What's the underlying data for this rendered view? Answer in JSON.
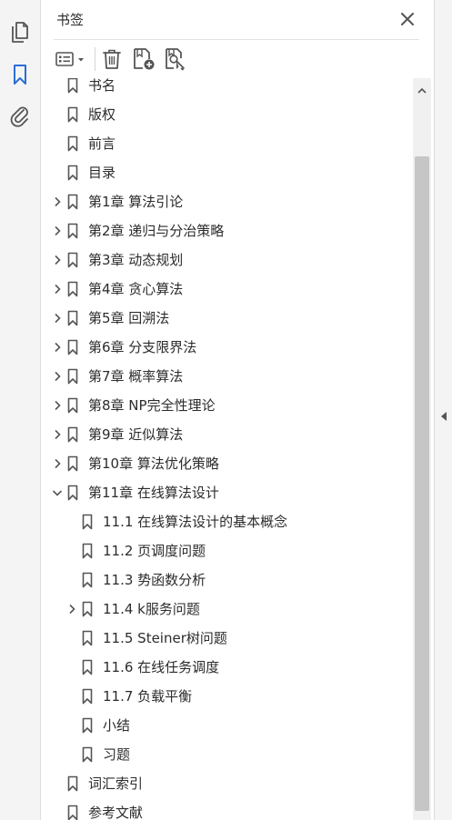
{
  "rail": {
    "items": [
      {
        "name": "page-thumbnails-icon",
        "color": "#555555"
      },
      {
        "name": "bookmark-icon",
        "color": "#2b6fd6"
      },
      {
        "name": "attachment-icon",
        "color": "#555555"
      }
    ]
  },
  "panel": {
    "title": "书签",
    "toolbar": [
      "options-menu-icon",
      "delete-icon",
      "new-bookmark-icon",
      "find-bookmark-icon"
    ]
  },
  "bookmarks": [
    {
      "label": "书名",
      "level": 0,
      "expandable": false,
      "expanded": false
    },
    {
      "label": "版权",
      "level": 0,
      "expandable": false,
      "expanded": false
    },
    {
      "label": "前言",
      "level": 0,
      "expandable": false,
      "expanded": false
    },
    {
      "label": "目录",
      "level": 0,
      "expandable": false,
      "expanded": false
    },
    {
      "label": "第1章 算法引论",
      "level": 0,
      "expandable": true,
      "expanded": false
    },
    {
      "label": "第2章 递归与分治策略",
      "level": 0,
      "expandable": true,
      "expanded": false
    },
    {
      "label": "第3章 动态规划",
      "level": 0,
      "expandable": true,
      "expanded": false
    },
    {
      "label": "第4章 贪心算法",
      "level": 0,
      "expandable": true,
      "expanded": false
    },
    {
      "label": "第5章 回溯法",
      "level": 0,
      "expandable": true,
      "expanded": false
    },
    {
      "label": "第6章 分支限界法",
      "level": 0,
      "expandable": true,
      "expanded": false
    },
    {
      "label": "第7章 概率算法",
      "level": 0,
      "expandable": true,
      "expanded": false
    },
    {
      "label": "第8章 NP完全性理论",
      "level": 0,
      "expandable": true,
      "expanded": false
    },
    {
      "label": "第9章 近似算法",
      "level": 0,
      "expandable": true,
      "expanded": false
    },
    {
      "label": "第10章 算法优化策略",
      "level": 0,
      "expandable": true,
      "expanded": false
    },
    {
      "label": "第11章 在线算法设计",
      "level": 0,
      "expandable": true,
      "expanded": true
    },
    {
      "label": "11.1 在线算法设计的基本概念",
      "level": 1,
      "expandable": false,
      "expanded": false
    },
    {
      "label": "11.2 页调度问题",
      "level": 1,
      "expandable": false,
      "expanded": false
    },
    {
      "label": "11.3 势函数分析",
      "level": 1,
      "expandable": false,
      "expanded": false
    },
    {
      "label": "11.4 k服务问题",
      "level": 1,
      "expandable": true,
      "expanded": false
    },
    {
      "label": "11.5 Steiner树问题",
      "level": 1,
      "expandable": false,
      "expanded": false
    },
    {
      "label": "11.6 在线任务调度",
      "level": 1,
      "expandable": false,
      "expanded": false
    },
    {
      "label": "11.7 负载平衡",
      "level": 1,
      "expandable": false,
      "expanded": false
    },
    {
      "label": "小结",
      "level": 1,
      "expandable": false,
      "expanded": false
    },
    {
      "label": "习题",
      "level": 1,
      "expandable": false,
      "expanded": false
    },
    {
      "label": "词汇索引",
      "level": 0,
      "expandable": false,
      "expanded": false
    },
    {
      "label": "参考文献",
      "level": 0,
      "expandable": false,
      "expanded": false
    }
  ],
  "colors": {
    "icon": "#555555",
    "accent": "#2b6fd6",
    "text": "#2c2c2c"
  }
}
